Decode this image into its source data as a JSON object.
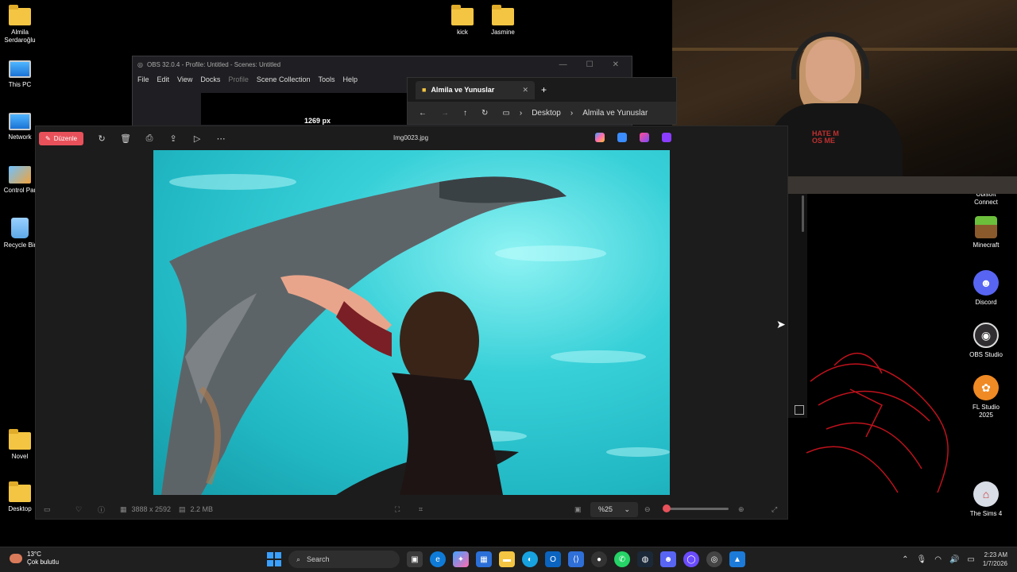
{
  "desktop": {
    "icons_left": [
      {
        "label": "Almila\nSerdaroğlu",
        "icon": "folder-icon"
      },
      {
        "label": "This PC",
        "icon": "monitor-icon"
      },
      {
        "label": "Network",
        "icon": "network-icon"
      },
      {
        "label": "Control Par",
        "icon": "control-panel-icon"
      },
      {
        "label": "Recycle Bir",
        "icon": "recycle-bin-icon"
      },
      {
        "label": "Novel",
        "icon": "folder-icon"
      },
      {
        "label": "Desktop",
        "icon": "folder-icon"
      }
    ],
    "icons_top": [
      {
        "label": "kick",
        "icon": "folder-icon"
      },
      {
        "label": "Jasmine",
        "icon": "folder-icon"
      }
    ],
    "icons_right": [
      {
        "label": "Ubisoft\nConnect",
        "icon": "ubisoft-icon"
      },
      {
        "label": "Minecraft",
        "icon": "minecraft-icon"
      },
      {
        "label": "Discord",
        "icon": "discord-icon"
      },
      {
        "label": "OBS Studio",
        "icon": "obs-icon"
      },
      {
        "label": "FL Studio\n2025",
        "icon": "fl-studio-icon"
      },
      {
        "label": "The Sims 4",
        "icon": "sims-icon"
      }
    ]
  },
  "webcam": {
    "shirt_text": "HATE M\nOS ME"
  },
  "obs": {
    "title": "OBS 32.0.4 - Profile: Untitled - Scenes: Untitled",
    "menu": [
      "File",
      "Edit",
      "View",
      "Docks",
      "Profile",
      "Scene Collection",
      "Tools",
      "Help"
    ],
    "preview_px": "1269 px"
  },
  "explorer": {
    "tab_title": "Almila ve Yunuslar",
    "breadcrumb": [
      "Desktop",
      "Almila ve Yunuslar"
    ]
  },
  "photos": {
    "edit_label": "Düzenle",
    "filename": "Img0023.jpg",
    "dimensions": "3888 x 2592",
    "file_size": "2.2 MB",
    "zoom": "%25",
    "zoom_level": 0.0
  },
  "taskbar": {
    "temperature": "13°C",
    "weather": "Çok bulutlu",
    "search_placeholder": "Search",
    "time": "2:23 AM",
    "date": "1/7/2026"
  },
  "colors": {
    "accent": "#e8515a",
    "water": "#38d0d8",
    "taskbar": "#1f1f1f"
  }
}
